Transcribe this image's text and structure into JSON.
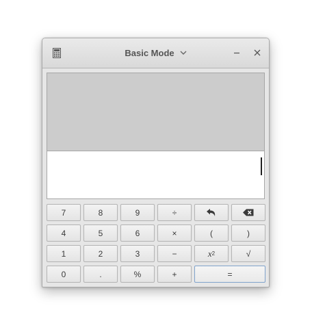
{
  "titlebar": {
    "title": "Basic Mode",
    "icons": {
      "app": "calculator-icon",
      "mode_menu": "chevron-down-icon",
      "minimize": "minimize-icon",
      "close": "close-icon"
    }
  },
  "display": {
    "history": "",
    "entry": ""
  },
  "keypad": {
    "row1": [
      "7",
      "8",
      "9",
      "÷",
      "",
      ""
    ],
    "row2": [
      "4",
      "5",
      "6",
      "×",
      "(",
      ")"
    ],
    "row3": [
      "1",
      "2",
      "3",
      "−",
      "x",
      "√"
    ],
    "row3_superscript": "2",
    "row4": [
      "0",
      ".",
      "%",
      "+",
      "="
    ],
    "icon_keys": {
      "undo": "undo-icon",
      "backspace": "backspace-icon"
    }
  }
}
